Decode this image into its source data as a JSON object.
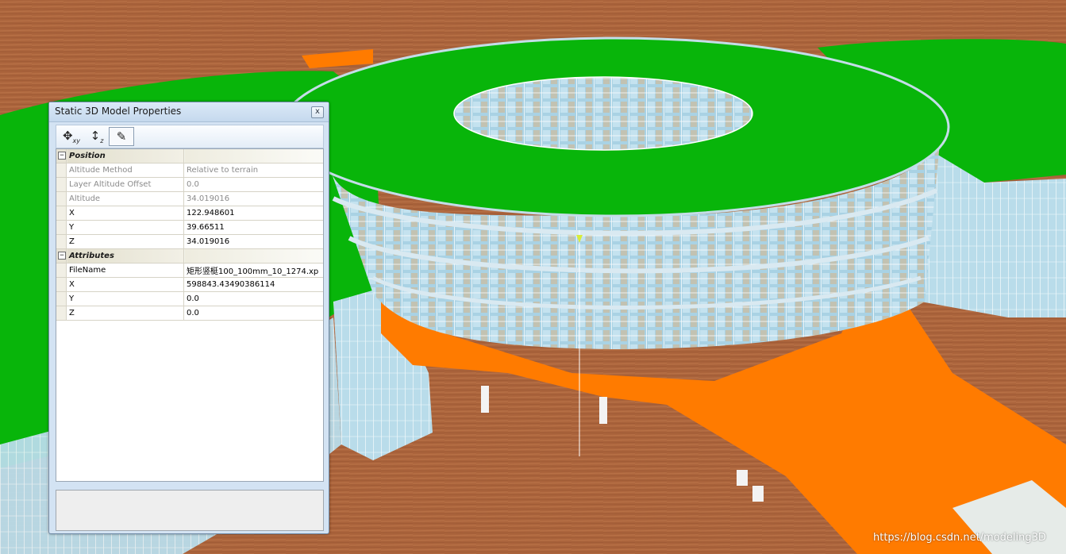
{
  "dialog": {
    "title": "Static 3D Model Properties",
    "close_label": "x",
    "toolbar": [
      {
        "icon": "move-xy-icon",
        "glyph": "✥",
        "sub": "xy"
      },
      {
        "icon": "move-z-icon",
        "glyph": "↕",
        "sub": "z"
      },
      {
        "icon": "edit-pen-icon",
        "glyph": "✎",
        "sub": ""
      }
    ]
  },
  "properties": {
    "position": {
      "label": "Position",
      "rows": [
        {
          "name": "Altitude Method",
          "value": "Relative to terrain",
          "readonly": true
        },
        {
          "name": "Layer Altitude Offset",
          "value": "0.0",
          "readonly": true
        },
        {
          "name": "Altitude",
          "value": "34.019016",
          "readonly": true
        },
        {
          "name": "X",
          "value": "122.948601",
          "readonly": false
        },
        {
          "name": "Y",
          "value": "39.66511",
          "readonly": false
        },
        {
          "name": "Z",
          "value": "34.019016",
          "readonly": false
        }
      ]
    },
    "attributes": {
      "label": "Attributes",
      "rows": [
        {
          "name": "FileName",
          "value": "矩形竖梃100_100mm_10_1274.xp",
          "readonly": false
        },
        {
          "name": "X",
          "value": "598843.43490386114",
          "readonly": false
        },
        {
          "name": "Y",
          "value": "0.0",
          "readonly": false
        },
        {
          "name": "Z",
          "value": "0.0",
          "readonly": false
        }
      ]
    },
    "expander_glyph": "−"
  },
  "watermark": "https://blog.csdn.net/modeling3D",
  "colors": {
    "terrain": "#a9623a",
    "roof": "#08b50a",
    "plaza": "#ff7b00",
    "glass": "#b3d6e6"
  }
}
